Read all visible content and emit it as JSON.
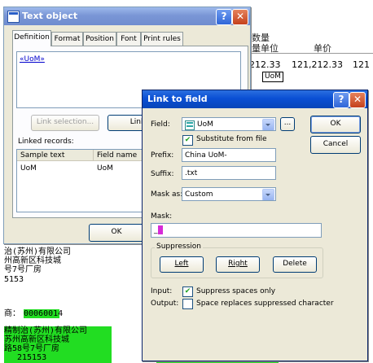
{
  "background_doc": {
    "header_cn_1": "数量",
    "header_cn_2": "量单位",
    "header_cn_3": "单价",
    "row_value_1": "212.33",
    "row_value_2": "121,212.33",
    "row_value_3": "121",
    "uom_cell": "UoM",
    "company_lines": [
      "治(苏州)有限公司",
      "州高新区科技城",
      "号7号厂房",
      "5153"
    ],
    "code_label": "商：",
    "code_value": "00060014",
    "green_lines": [
      "精制治(苏州)有限公司",
      "苏州高新区科技城",
      "路58号7号厂房",
      "215153"
    ]
  },
  "text_object": {
    "title": "Text object",
    "help_btn": "?",
    "close_btn": "✕",
    "tabs": [
      "Definition",
      "Format",
      "Position",
      "Font",
      "Print rules"
    ],
    "content": "«UoM»",
    "link_selection_btn": "Link selection...",
    "link_btn": "Link",
    "linked_records_label": "Linked records:",
    "columns": [
      "Sample text",
      "Field name"
    ],
    "rows": [
      {
        "sample": "UoM",
        "field": "UoM"
      }
    ],
    "ok_btn": "OK"
  },
  "link_to_field": {
    "title": "Link to field",
    "help_btn": "?",
    "close_btn": "✕",
    "field_label": "Field:",
    "field_value": "UoM",
    "browse_btn": "...",
    "ok_btn": "OK",
    "cancel_btn": "Cancel",
    "substitute_label": "Substitute from file",
    "substitute_checked": true,
    "prefix_label": "Prefix:",
    "prefix_value": "China UoM-",
    "suffix_label": "Suffix:",
    "suffix_value": ".txt",
    "mask_as_label": "Mask as:",
    "mask_as_value": "Custom",
    "mask_label": "Mask:",
    "mask_value": "_",
    "suppression_label": "Suppression",
    "left_btn": "Left",
    "right_btn": "Right",
    "delete_btn": "Delete",
    "input_label": "Input:",
    "suppress_spaces_label": "Suppress spaces only",
    "suppress_spaces_checked": true,
    "output_label": "Output:",
    "space_replaces_label": "Space replaces suppressed character",
    "space_replaces_checked": false,
    "accent_color": "#0a4fd4",
    "highlight_color": "#22dd22"
  }
}
